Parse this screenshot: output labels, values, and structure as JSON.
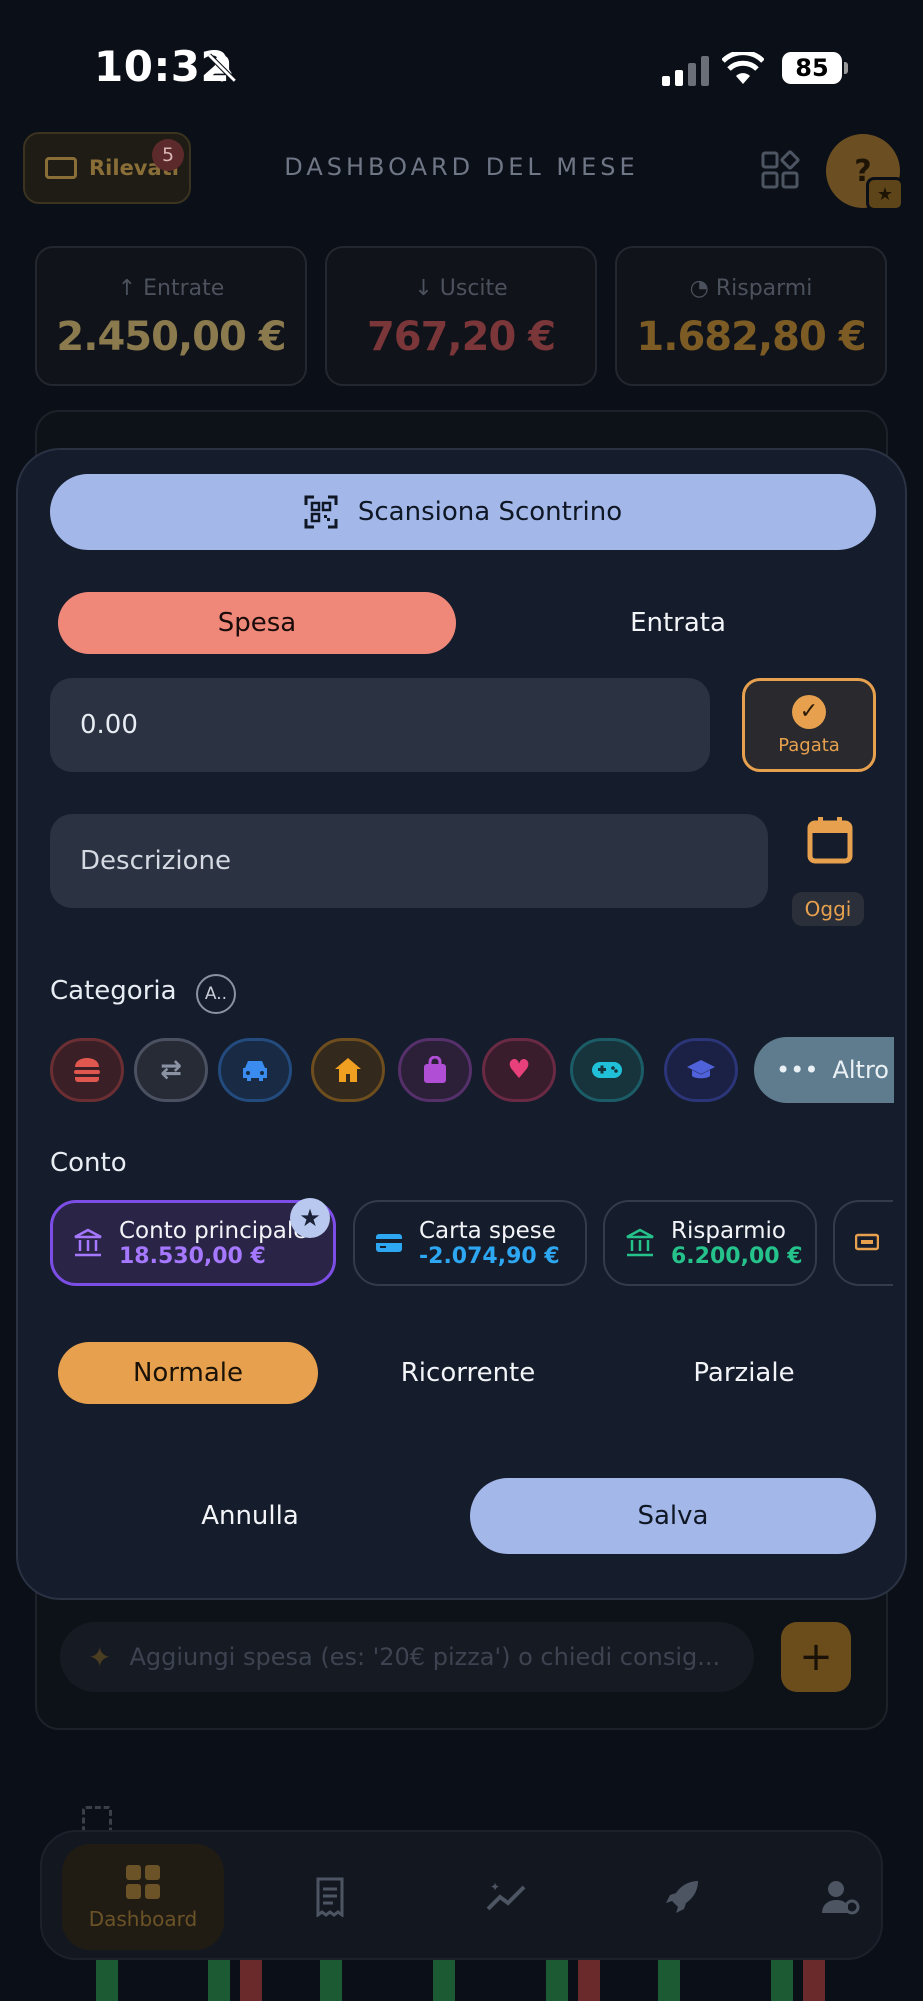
{
  "status_bar": {
    "time": "10:32",
    "battery": "85"
  },
  "header": {
    "detected_label": "Rilevati",
    "detected_count": "5",
    "title": "DASHBOARD DEL MESE",
    "help_symbol": "?"
  },
  "stats": [
    {
      "label": "Entrate",
      "value": "2.450,00 €",
      "color": "#8a7a4d",
      "icon": "arrow-up-icon"
    },
    {
      "label": "Uscite",
      "value": "767,20 €",
      "color": "#7a3638",
      "icon": "arrow-down-icon"
    },
    {
      "label": "Risparmi",
      "value": "1.682,80 €",
      "color": "#7c5c24",
      "icon": "piggy-bank-icon"
    }
  ],
  "modal": {
    "scan_label": "Scansiona Scontrino",
    "type_tabs": [
      "Spesa",
      "Entrata"
    ],
    "amount_value": "0.00",
    "paid_label": "Pagata",
    "description_placeholder": "Descrizione",
    "today_label": "Oggi",
    "category_label": "Categoria",
    "sort_label": "A..",
    "categories": [
      {
        "name": "food-icon",
        "color": "#e0574f"
      },
      {
        "name": "transfer-icon",
        "color": "#8a92a3"
      },
      {
        "name": "car-icon",
        "color": "#3b8cf0"
      },
      {
        "name": "home-icon",
        "color": "#f0a020"
      },
      {
        "name": "shopping-bag-icon",
        "color": "#b04fd6"
      },
      {
        "name": "health-icon",
        "color": "#e8407a"
      },
      {
        "name": "gamepad-icon",
        "color": "#1fc0d8"
      },
      {
        "name": "graduation-cap-icon",
        "color": "#4f62d9"
      }
    ],
    "more_label": "Altro",
    "account_label": "Conto",
    "accounts": [
      {
        "name": "Conto principale",
        "balance": "18.530,00 €",
        "color": "#a578ff",
        "icon": "bank-icon"
      },
      {
        "name": "Carta spese",
        "balance": "-2.074,90 €",
        "color": "#2ea7f2",
        "icon": "card-icon"
      },
      {
        "name": "Risparmio",
        "balance": "6.200,00 €",
        "color": "#25c28c",
        "icon": "bank-icon"
      }
    ],
    "mode_tabs": [
      "Normale",
      "Ricorrente",
      "Parziale"
    ],
    "cancel_label": "Annulla",
    "save_label": "Salva"
  },
  "ai_input": {
    "placeholder": "Aggiungi spesa (es: '20€ pizza') o chiedi consig..."
  },
  "nav": {
    "items": [
      "Dashboard"
    ]
  }
}
